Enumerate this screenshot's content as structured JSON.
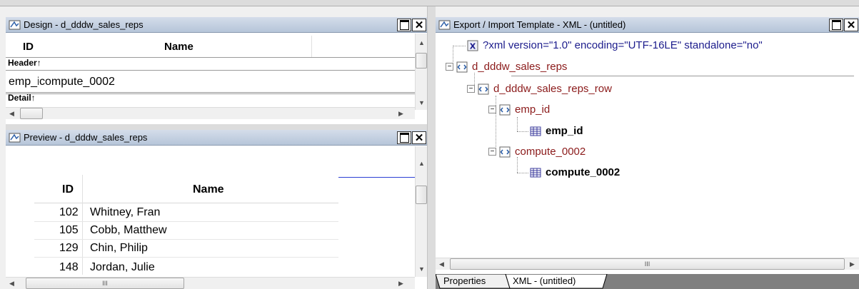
{
  "design": {
    "title": "Design - d_dddw_sales_reps",
    "col_id": "ID",
    "col_name": "Name",
    "band_header": "Header↑",
    "row_id": "emp_iđ",
    "row_name": "compute_0002",
    "band_detail": "Detail↑"
  },
  "preview": {
    "title": "Preview - d_dddw_sales_reps",
    "col_id": "ID",
    "col_name": "Name",
    "rows": [
      {
        "id": "102",
        "name": "Whitney, Fran"
      },
      {
        "id": "105",
        "name": "Cobb, Matthew"
      },
      {
        "id": "129",
        "name": "Chin, Philip"
      },
      {
        "id": "148",
        "name": "Jordan, Julie"
      }
    ]
  },
  "xml": {
    "title": "Export / Import Template - XML - (untitled)",
    "declaration": "?xml version=\"1.0\" encoding=\"UTF-16LE\" standalone=\"no\"",
    "root": "d_dddw_sales_reps",
    "row_element": "d_dddw_sales_reps_row",
    "emp_element": "emp_id",
    "emp_column": "emp_id",
    "compute_element": "compute_0002",
    "compute_column": "compute_0002"
  },
  "tabs": {
    "properties": "Properties",
    "xml": "XML - (untitled)"
  },
  "colors": {
    "title_gradient_top": "#d4ddea",
    "element_text": "#8b1a1a",
    "declaration_text": "#1c1c8c"
  }
}
